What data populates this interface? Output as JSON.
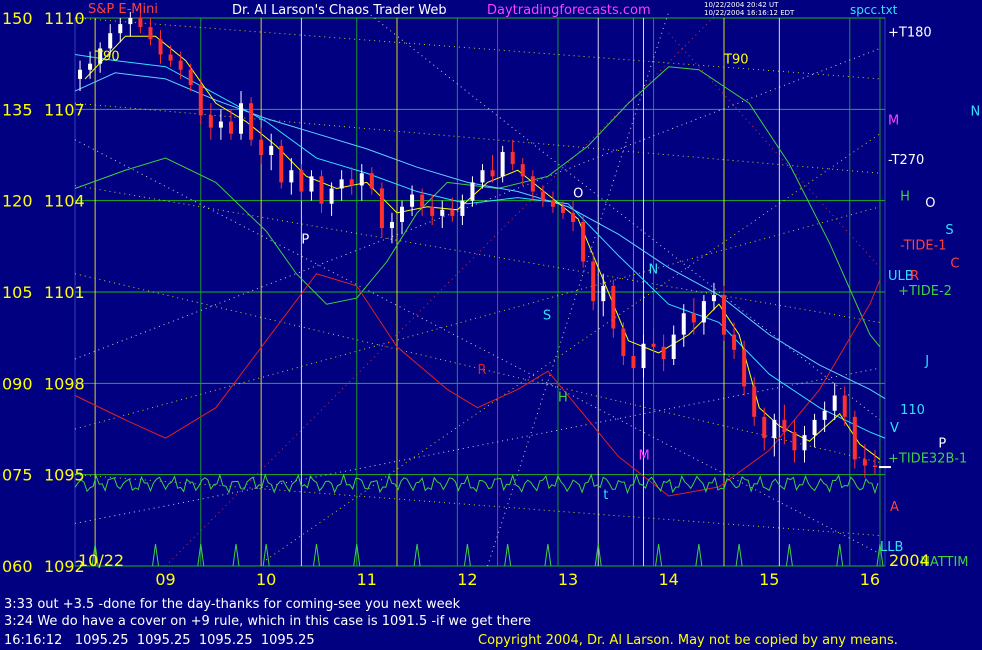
{
  "header": {
    "instrument": "S&P E-Mini",
    "title": "Dr. Al Larson's Chaos Trader Web",
    "site": "Daytradingforecasts.com",
    "stamp_line1": "10/22/2004 20:42 UT",
    "stamp_line2": "10/22/2004 16:16:12 EDT",
    "file": "spcc.txt"
  },
  "colors": {
    "background": "#000080",
    "price_up": "#ffffff",
    "price_down": "#ff3030",
    "axis_text": "#ffff00",
    "ema_short": "#ffff00",
    "ema_mid": "#30e0ff",
    "ema_long": "#60d0ff",
    "green_line": "#40d040",
    "red_line": "#e02020",
    "grid_green": "#20b020",
    "grid_yellow": "#ffff00",
    "grid_white": "#ffffff",
    "grid_magenta": "#ff40ff",
    "grid_red": "#e04040"
  },
  "chart_data": {
    "type": "candlestick",
    "title": "S&P E-Mini",
    "left_axis_ticks": [
      "150",
      "135",
      "120",
      "105",
      "090",
      "075",
      "060"
    ],
    "right_axis_ticks": [
      "1110",
      "1107",
      "1104",
      "1101",
      "1098",
      "1095",
      "1092"
    ],
    "price_range": [
      1092,
      1110
    ],
    "x_ticks": [
      "09",
      "10",
      "11",
      "12",
      "13",
      "14",
      "15",
      "16"
    ],
    "x_tick_values": [
      9,
      10,
      11,
      12,
      13,
      14,
      15,
      16
    ],
    "x_range": [
      8.1,
      16.15
    ],
    "start_date": "10/22",
    "year": "2004",
    "grid": true,
    "ohlc": [
      [
        8.15,
        1108.0,
        1108.6,
        1107.6,
        1108.3
      ],
      [
        8.25,
        1108.3,
        1108.9,
        1108.0,
        1108.5
      ],
      [
        8.35,
        1108.5,
        1109.2,
        1108.2,
        1109.0
      ],
      [
        8.45,
        1109.0,
        1109.8,
        1108.8,
        1109.5
      ],
      [
        8.55,
        1109.5,
        1110.0,
        1109.2,
        1109.8
      ],
      [
        8.65,
        1109.8,
        1110.2,
        1109.4,
        1110.0
      ],
      [
        8.75,
        1110.0,
        1110.4,
        1109.5,
        1109.7
      ],
      [
        8.85,
        1109.7,
        1110.0,
        1109.1,
        1109.3
      ],
      [
        8.95,
        1109.3,
        1109.6,
        1108.5,
        1108.8
      ],
      [
        9.05,
        1108.8,
        1109.1,
        1108.4,
        1108.6
      ],
      [
        9.15,
        1108.6,
        1108.9,
        1108.0,
        1108.3
      ],
      [
        9.25,
        1108.3,
        1108.5,
        1107.6,
        1107.8
      ],
      [
        9.35,
        1107.8,
        1108.0,
        1106.5,
        1106.8
      ],
      [
        9.45,
        1106.8,
        1107.2,
        1106.0,
        1106.4
      ],
      [
        9.55,
        1106.4,
        1107.0,
        1106.0,
        1106.6
      ],
      [
        9.65,
        1106.6,
        1107.0,
        1106.0,
        1106.2
      ],
      [
        9.75,
        1106.2,
        1107.6,
        1106.0,
        1107.2
      ],
      [
        9.85,
        1107.2,
        1107.4,
        1105.8,
        1106.0
      ],
      [
        9.95,
        1106.0,
        1106.4,
        1105.2,
        1105.5
      ],
      [
        10.05,
        1105.5,
        1106.2,
        1105.0,
        1105.8
      ],
      [
        10.15,
        1105.8,
        1106.0,
        1104.4,
        1104.6
      ],
      [
        10.25,
        1104.6,
        1105.4,
        1104.2,
        1105.0
      ],
      [
        10.35,
        1105.0,
        1105.2,
        1104.0,
        1104.3
      ],
      [
        10.45,
        1104.3,
        1105.0,
        1104.0,
        1104.8
      ],
      [
        10.55,
        1104.8,
        1105.0,
        1103.6,
        1103.9
      ],
      [
        10.65,
        1103.9,
        1104.6,
        1103.5,
        1104.4
      ],
      [
        10.75,
        1104.4,
        1105.0,
        1104.0,
        1104.7
      ],
      [
        10.85,
        1104.7,
        1105.1,
        1104.2,
        1104.5
      ],
      [
        10.95,
        1104.5,
        1105.2,
        1104.0,
        1104.9
      ],
      [
        11.05,
        1104.9,
        1105.1,
        1104.2,
        1104.4
      ],
      [
        11.15,
        1104.4,
        1104.6,
        1102.8,
        1103.1
      ],
      [
        11.25,
        1103.1,
        1103.6,
        1102.6,
        1103.3
      ],
      [
        11.35,
        1103.3,
        1104.0,
        1102.9,
        1103.8
      ],
      [
        11.45,
        1103.8,
        1104.5,
        1103.5,
        1104.2
      ],
      [
        11.55,
        1104.2,
        1104.4,
        1103.5,
        1103.8
      ],
      [
        11.65,
        1103.8,
        1104.2,
        1103.2,
        1103.5
      ],
      [
        11.75,
        1103.5,
        1104.0,
        1103.1,
        1103.7
      ],
      [
        11.85,
        1103.7,
        1104.1,
        1103.3,
        1103.5
      ],
      [
        11.95,
        1103.5,
        1104.2,
        1103.2,
        1104.0
      ],
      [
        12.05,
        1104.0,
        1104.8,
        1103.8,
        1104.6
      ],
      [
        12.15,
        1104.6,
        1105.2,
        1104.4,
        1105.0
      ],
      [
        12.25,
        1105.0,
        1105.5,
        1104.6,
        1104.8
      ],
      [
        12.35,
        1104.8,
        1105.8,
        1104.6,
        1105.6
      ],
      [
        12.45,
        1105.6,
        1106.0,
        1105.0,
        1105.2
      ],
      [
        12.55,
        1105.2,
        1105.4,
        1104.5,
        1104.8
      ],
      [
        12.65,
        1104.8,
        1105.0,
        1104.0,
        1104.3
      ],
      [
        12.75,
        1104.3,
        1104.5,
        1103.8,
        1104.0
      ],
      [
        12.85,
        1104.0,
        1104.3,
        1103.6,
        1103.8
      ],
      [
        12.95,
        1103.8,
        1104.0,
        1103.4,
        1103.6
      ],
      [
        13.05,
        1103.6,
        1104.0,
        1103.0,
        1103.3
      ],
      [
        13.15,
        1103.3,
        1103.5,
        1101.8,
        1102.0
      ],
      [
        13.25,
        1102.0,
        1102.3,
        1100.4,
        1100.7
      ],
      [
        13.35,
        1100.7,
        1101.6,
        1100.2,
        1101.2
      ],
      [
        13.45,
        1101.2,
        1101.4,
        1099.5,
        1099.8
      ],
      [
        13.55,
        1099.8,
        1100.0,
        1098.6,
        1098.9
      ],
      [
        13.65,
        1098.9,
        1099.3,
        1098.0,
        1098.5
      ],
      [
        13.75,
        1098.5,
        1099.6,
        1098.2,
        1099.3
      ],
      [
        13.85,
        1099.3,
        1099.8,
        1098.8,
        1099.2
      ],
      [
        13.95,
        1099.2,
        1099.6,
        1098.4,
        1098.8
      ],
      [
        14.05,
        1098.8,
        1099.9,
        1098.6,
        1099.6
      ],
      [
        14.15,
        1099.6,
        1100.6,
        1099.2,
        1100.3
      ],
      [
        14.25,
        1100.3,
        1100.8,
        1099.6,
        1100.0
      ],
      [
        14.35,
        1100.0,
        1100.9,
        1099.6,
        1100.7
      ],
      [
        14.45,
        1100.7,
        1101.3,
        1100.4,
        1100.9
      ],
      [
        14.55,
        1100.9,
        1101.2,
        1099.4,
        1099.6
      ],
      [
        14.65,
        1099.6,
        1100.0,
        1098.8,
        1099.1
      ],
      [
        14.75,
        1099.1,
        1099.4,
        1097.6,
        1097.9
      ],
      [
        14.85,
        1097.9,
        1098.2,
        1096.6,
        1096.9
      ],
      [
        14.95,
        1096.9,
        1097.2,
        1095.8,
        1096.2
      ],
      [
        15.05,
        1096.2,
        1097.0,
        1095.6,
        1096.8
      ],
      [
        15.15,
        1096.8,
        1097.3,
        1096.0,
        1096.4
      ],
      [
        15.25,
        1096.4,
        1096.8,
        1095.4,
        1095.8
      ],
      [
        15.35,
        1095.8,
        1096.6,
        1095.4,
        1096.3
      ],
      [
        15.45,
        1096.3,
        1097.0,
        1095.9,
        1096.8
      ],
      [
        15.55,
        1096.8,
        1097.4,
        1096.4,
        1097.1
      ],
      [
        15.65,
        1097.1,
        1098.0,
        1096.8,
        1097.6
      ],
      [
        15.75,
        1097.6,
        1097.9,
        1096.6,
        1096.9
      ],
      [
        15.85,
        1096.9,
        1097.1,
        1095.2,
        1095.5
      ],
      [
        15.95,
        1095.5,
        1096.0,
        1094.9,
        1095.3
      ],
      [
        16.05,
        1095.3,
        1095.8,
        1095.0,
        1095.25
      ]
    ],
    "ema_short": [
      [
        8.2,
        1108.0
      ],
      [
        8.6,
        1109.4
      ],
      [
        8.9,
        1109.4
      ],
      [
        9.2,
        1108.6
      ],
      [
        9.5,
        1107.2
      ],
      [
        9.8,
        1106.6
      ],
      [
        10.1,
        1105.8
      ],
      [
        10.4,
        1104.8
      ],
      [
        10.7,
        1104.4
      ],
      [
        11.0,
        1104.6
      ],
      [
        11.3,
        1103.6
      ],
      [
        11.6,
        1103.8
      ],
      [
        11.9,
        1103.7
      ],
      [
        12.2,
        1104.6
      ],
      [
        12.5,
        1105.0
      ],
      [
        12.8,
        1104.2
      ],
      [
        13.1,
        1103.4
      ],
      [
        13.3,
        1101.8
      ],
      [
        13.6,
        1099.4
      ],
      [
        13.9,
        1099.0
      ],
      [
        14.2,
        1099.6
      ],
      [
        14.5,
        1100.6
      ],
      [
        14.7,
        1099.6
      ],
      [
        14.9,
        1097.2
      ],
      [
        15.1,
        1096.6
      ],
      [
        15.4,
        1096.1
      ],
      [
        15.7,
        1097.0
      ],
      [
        15.9,
        1096.0
      ],
      [
        16.1,
        1095.5
      ]
    ],
    "ema_mid": [
      [
        8.1,
        1108.8
      ],
      [
        8.5,
        1108.6
      ],
      [
        9.0,
        1108.4
      ],
      [
        9.5,
        1107.5
      ],
      [
        10.0,
        1106.6
      ],
      [
        10.5,
        1105.4
      ],
      [
        11.0,
        1104.9
      ],
      [
        11.5,
        1104.3
      ],
      [
        12.0,
        1103.9
      ],
      [
        12.5,
        1104.1
      ],
      [
        13.0,
        1103.9
      ],
      [
        13.5,
        1102.2
      ],
      [
        14.0,
        1100.6
      ],
      [
        14.5,
        1100.0
      ],
      [
        15.0,
        1098.3
      ],
      [
        15.5,
        1097.2
      ],
      [
        16.0,
        1096.4
      ],
      [
        16.15,
        1096.2
      ]
    ],
    "ema_long": [
      [
        8.1,
        1107.6
      ],
      [
        8.5,
        1108.2
      ],
      [
        9.0,
        1108.0
      ],
      [
        9.5,
        1107.3
      ],
      [
        10.0,
        1106.7
      ],
      [
        10.5,
        1106.2
      ],
      [
        11.0,
        1105.7
      ],
      [
        11.5,
        1105.1
      ],
      [
        12.0,
        1104.6
      ],
      [
        12.5,
        1104.3
      ],
      [
        13.0,
        1103.8
      ],
      [
        13.5,
        1102.9
      ],
      [
        14.0,
        1101.8
      ],
      [
        14.5,
        1100.9
      ],
      [
        15.0,
        1099.6
      ],
      [
        15.5,
        1098.6
      ],
      [
        16.0,
        1097.8
      ],
      [
        16.15,
        1097.5
      ]
    ],
    "labels": [
      {
        "text": "T90",
        "x": 8.3,
        "y": 1108.6,
        "color": "#ffff00"
      },
      {
        "text": "P",
        "x": 10.35,
        "y": 1102.6,
        "color": "#ffffff"
      },
      {
        "text": "O",
        "x": 13.05,
        "y": 1104.1,
        "color": "#ffffff"
      },
      {
        "text": "N",
        "x": 13.8,
        "y": 1101.6,
        "color": "#30e0ff"
      },
      {
        "text": "S",
        "x": 12.75,
        "y": 1100.1,
        "color": "#30e0ff"
      },
      {
        "text": "R",
        "x": 12.1,
        "y": 1098.3,
        "color": "#e02020"
      },
      {
        "text": "H",
        "x": 12.9,
        "y": 1097.4,
        "color": "#40d040"
      },
      {
        "text": "M",
        "x": 13.7,
        "y": 1095.5,
        "color": "#ff40ff"
      },
      {
        "text": "t",
        "x": 13.35,
        "y": 1094.2,
        "color": "#30e0ff"
      },
      {
        "text": "T90",
        "x": 14.55,
        "y": 1108.5,
        "color": "#ffff00"
      },
      {
        "text": "+T180",
        "x": 16.18,
        "y": 1109.4,
        "color": "#ffffff"
      },
      {
        "text": "M",
        "x": 16.18,
        "y": 1106.5,
        "color": "#ff40ff"
      },
      {
        "text": "-T270",
        "x": 16.18,
        "y": 1105.2,
        "color": "#ffffff"
      },
      {
        "text": "H",
        "x": 16.3,
        "y": 1104.0,
        "color": "#40d040"
      },
      {
        "text": "-TIDE-1",
        "x": 16.3,
        "y": 1102.4,
        "color": "#ff4040"
      },
      {
        "text": "C",
        "x": 16.8,
        "y": 1101.8,
        "color": "#ff4040"
      },
      {
        "text": "ULB",
        "x": 16.18,
        "y": 1101.4,
        "color": "#30e0ff"
      },
      {
        "text": "+TIDE-2",
        "x": 16.28,
        "y": 1100.9,
        "color": "#40d040"
      },
      {
        "text": "110",
        "x": 16.3,
        "y": 1097.0,
        "color": "#30e0ff"
      },
      {
        "text": "+TIDE32B-1",
        "x": 16.18,
        "y": 1095.4,
        "color": "#40d040"
      },
      {
        "text": "A",
        "x": 16.2,
        "y": 1093.8,
        "color": "#ff4040"
      },
      {
        "text": "LLB",
        "x": 16.1,
        "y": 1092.5,
        "color": "#30e0ff"
      },
      {
        "text": "NATTIM",
        "x": 16.5,
        "y": 1092.0,
        "color": "#40d040"
      },
      {
        "text": "N",
        "x": 17.0,
        "y": 1106.8,
        "color": "#30e0ff"
      },
      {
        "text": "O",
        "x": 16.55,
        "y": 1103.8,
        "color": "#ffffff"
      },
      {
        "text": "S",
        "x": 16.75,
        "y": 1102.9,
        "color": "#30e0ff"
      },
      {
        "text": "R",
        "x": 16.4,
        "y": 1101.4,
        "color": "#ff4040"
      },
      {
        "text": "J",
        "x": 16.55,
        "y": 1098.6,
        "color": "#30e0ff"
      },
      {
        "text": "V",
        "x": 16.2,
        "y": 1096.4,
        "color": "#30e0ff"
      },
      {
        "text": "P",
        "x": 16.68,
        "y": 1095.9,
        "color": "#ffffff"
      }
    ]
  },
  "messages": [
    "3:33 out +3.5 -done for the day-thanks for coming-see you next week",
    "3:24 We do have a cover on +9 rule, which in this case is 1091.5 -if we get there"
  ],
  "status": {
    "time": "16:16:12",
    "prices": "1095.25  1095.25  1095.25  1095.25"
  },
  "copyright": "Copyright 2004, Dr. Al Larson. May not be copied by any means."
}
